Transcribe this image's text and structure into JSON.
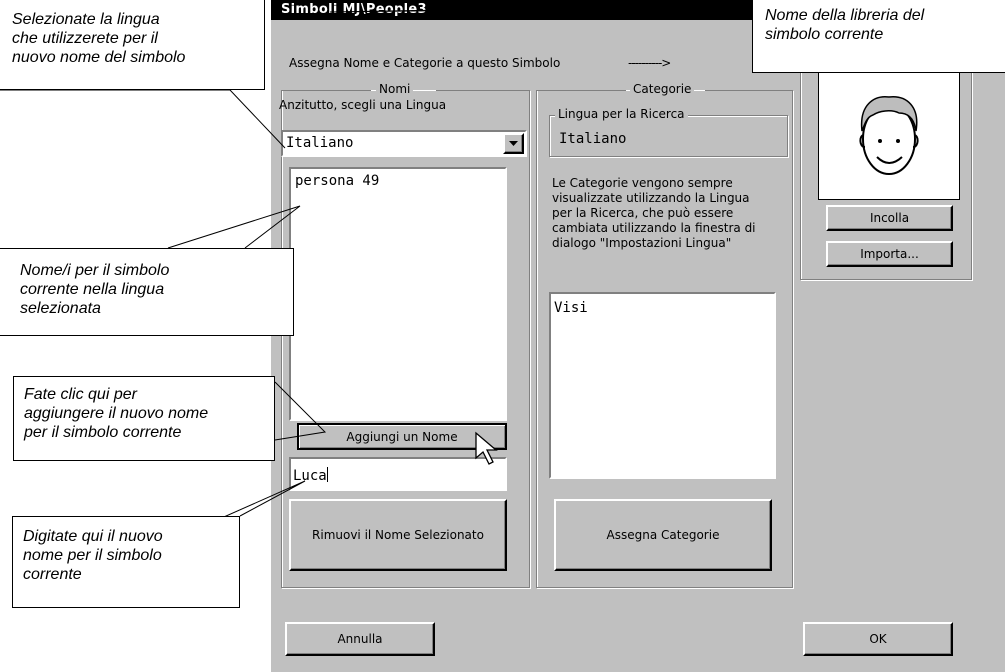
{
  "window": {
    "title": "Simboli MJ\\People3"
  },
  "header": {
    "instruction": "Assegna Nome e Categorie a questo Simbolo",
    "arrow": "---------->"
  },
  "nomi": {
    "group_label": "Nomi",
    "prompt": "Anzitutto, scegli una Lingua",
    "language_select": "Italiano",
    "names_list": [
      "persona 49"
    ],
    "add_button": "Aggiungi un Nome",
    "new_name_value": "Luca",
    "remove_button": "Rimuovi il Nome Selezionato"
  },
  "categorie": {
    "group_label": "Categorie",
    "search_language_label": "Lingua per la Ricerca",
    "search_language_value": "Italiano",
    "info_lines": [
      "Le Categorie vengono sempre",
      "visualizzate utilizzando la Lingua",
      "per la Ricerca, che può essere",
      "cambiata utilizzando la finestra di",
      "dialogo \"Impostazioni Lingua\""
    ],
    "categories_list": [
      "Visi"
    ],
    "assign_button": "Assegna Categorie"
  },
  "symbol_panel": {
    "paste_button": "Incolla",
    "import_button": "Importa..."
  },
  "footer": {
    "cancel_button": "Annulla",
    "ok_button": "OK"
  },
  "callouts": {
    "language": [
      "Selezionate la lingua",
      "che utilizzerete per il",
      "nuovo nome del simbolo"
    ],
    "library": [
      "Nome della libreria del",
      "simbolo corrente"
    ],
    "names": [
      "Nome/i per il simbolo",
      "corrente nella lingua",
      "selezionata"
    ],
    "add": [
      "Fate clic qui per",
      "aggiungere il nuovo nome",
      "per il simbolo corrente"
    ],
    "type": [
      "Digitate qui il nuovo",
      "nome per il simbolo",
      "corrente"
    ]
  }
}
